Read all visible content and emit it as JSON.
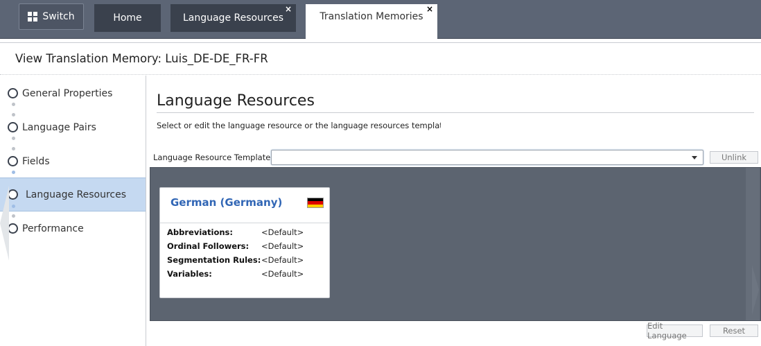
{
  "topbar": {
    "switch_label": "Switch",
    "tabs": [
      {
        "label": "Home"
      },
      {
        "label": "Language Resources",
        "close": "×"
      },
      {
        "label": "Translation Memories",
        "close": "×"
      }
    ]
  },
  "header": {
    "title": "View Translation Memory: Luis_DE-DE_FR-FR"
  },
  "leftnav": {
    "steps": [
      {
        "label": "General Properties"
      },
      {
        "label": "Language Pairs"
      },
      {
        "label": "Fields"
      },
      {
        "label": "Language Resources"
      },
      {
        "label": "Performance"
      }
    ]
  },
  "main": {
    "title": "Language Resources",
    "description": "Select or edit the language resource or the language resources template f",
    "template_label": "Language Resource Template",
    "template_value": "",
    "unlink_label": "Unlink",
    "edit_language_label": "Edit Language",
    "reset_label": "Reset"
  },
  "card": {
    "language": "German (Germany)",
    "flag_colors": [
      "#000000",
      "#dd0000",
      "#ffce00"
    ],
    "rows": [
      {
        "key": "Abbreviations:",
        "value": "<Default>"
      },
      {
        "key": "Ordinal Followers:",
        "value": "<Default>"
      },
      {
        "key": "Segmentation Rules:",
        "value": "<Default>"
      },
      {
        "key": "Variables:",
        "value": "<Default>"
      }
    ]
  }
}
